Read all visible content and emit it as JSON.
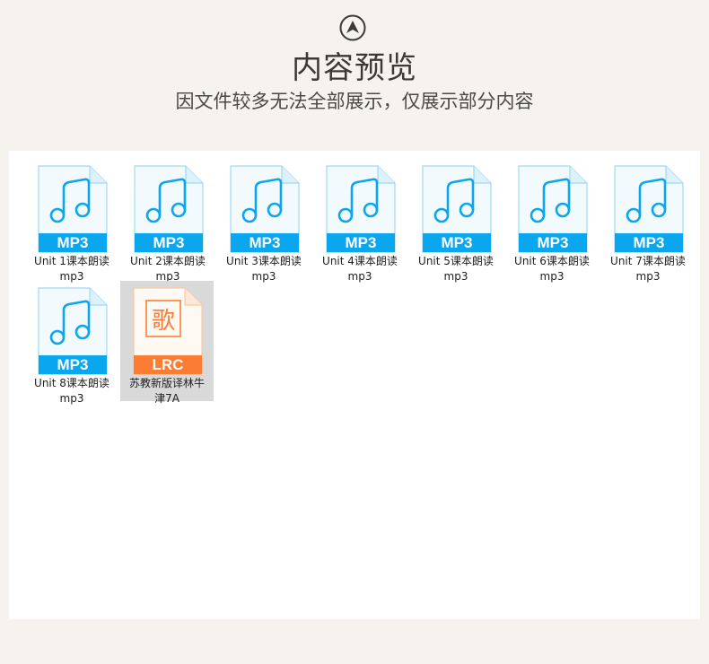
{
  "header": {
    "icon": "up-arrow-circle-icon",
    "title": "内容预览",
    "subtitle": "因文件较多无法全部展示，仅展示部分内容"
  },
  "colors": {
    "mp3_band": "#0aa7ef",
    "mp3_note": "#0aa7ef",
    "lrc_band": "#fb7d34",
    "lrc_glyph": "#fb7d34",
    "selected_bg": "#d9d9d9"
  },
  "files": [
    {
      "type": "MP3",
      "name_line1": "Unit 1课本朗读",
      "name_line2": "mp3"
    },
    {
      "type": "MP3",
      "name_line1": "Unit 2课本朗读",
      "name_line2": "mp3"
    },
    {
      "type": "MP3",
      "name_line1": "Unit 3课本朗读",
      "name_line2": "mp3"
    },
    {
      "type": "MP3",
      "name_line1": "Unit 4课本朗读",
      "name_line2": "mp3"
    },
    {
      "type": "MP3",
      "name_line1": "Unit 5课本朗读",
      "name_line2": "mp3"
    },
    {
      "type": "MP3",
      "name_line1": "Unit 6课本朗读",
      "name_line2": "mp3"
    },
    {
      "type": "MP3",
      "name_line1": "Unit 7课本朗读",
      "name_line2": "mp3"
    },
    {
      "type": "MP3",
      "name_line1": "Unit 8课本朗读",
      "name_line2": "mp3"
    },
    {
      "type": "LRC",
      "glyph": "歌",
      "name_line1": "苏教新版译林牛",
      "name_line2": "津7A",
      "selected": true
    }
  ]
}
